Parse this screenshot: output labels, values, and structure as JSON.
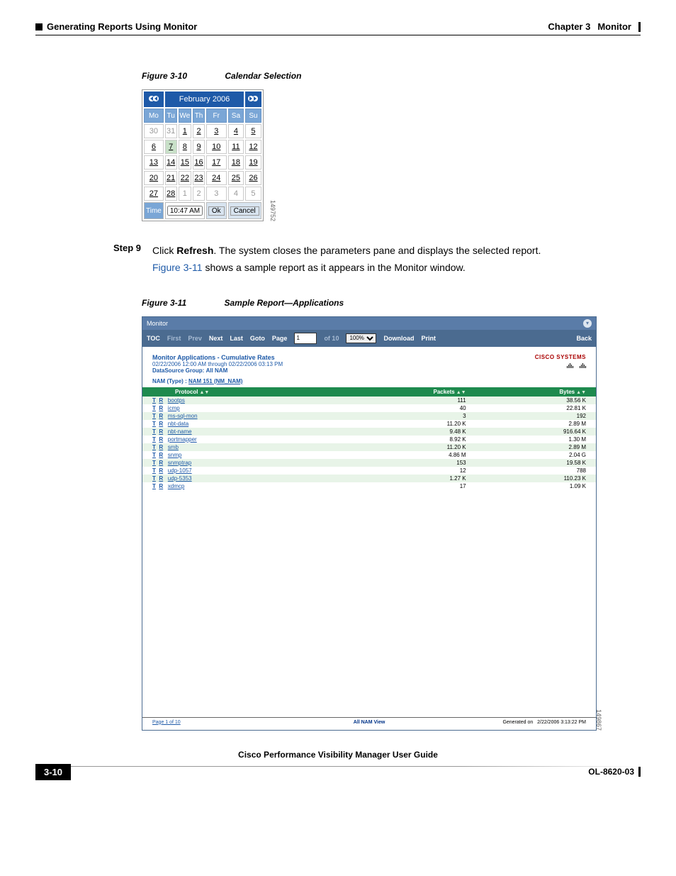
{
  "header": {
    "chapter": "Chapter 3",
    "chapter_title": "Monitor",
    "section": "Generating Reports Using Monitor"
  },
  "figure310": {
    "label": "Figure 3-10",
    "title": "Calendar Selection",
    "image_id": "149752"
  },
  "calendar": {
    "month": "February 2006",
    "dows": [
      "Mo",
      "Tu",
      "We",
      "Th",
      "Fr",
      "Sa",
      "Su"
    ],
    "rows": [
      [
        {
          "d": "30",
          "m": true
        },
        {
          "d": "31",
          "m": true
        },
        {
          "d": "1"
        },
        {
          "d": "2"
        },
        {
          "d": "3"
        },
        {
          "d": "4"
        },
        {
          "d": "5"
        }
      ],
      [
        {
          "d": "6"
        },
        {
          "d": "7",
          "sel": true
        },
        {
          "d": "8"
        },
        {
          "d": "9"
        },
        {
          "d": "10"
        },
        {
          "d": "11"
        },
        {
          "d": "12"
        }
      ],
      [
        {
          "d": "13"
        },
        {
          "d": "14"
        },
        {
          "d": "15"
        },
        {
          "d": "16"
        },
        {
          "d": "17"
        },
        {
          "d": "18"
        },
        {
          "d": "19"
        }
      ],
      [
        {
          "d": "20"
        },
        {
          "d": "21"
        },
        {
          "d": "22"
        },
        {
          "d": "23"
        },
        {
          "d": "24"
        },
        {
          "d": "25"
        },
        {
          "d": "26"
        }
      ],
      [
        {
          "d": "27"
        },
        {
          "d": "28"
        },
        {
          "d": "1",
          "m": true
        },
        {
          "d": "2",
          "m": true
        },
        {
          "d": "3",
          "m": true
        },
        {
          "d": "4",
          "m": true
        },
        {
          "d": "5",
          "m": true
        }
      ]
    ],
    "time_label": "Time",
    "time_value": "10:47 AM",
    "ok": "Ok",
    "cancel": "Cancel"
  },
  "step9": {
    "label": "Step 9",
    "text_before": "Click ",
    "bold": "Refresh",
    "text_after": ". The system closes the parameters pane and displays the selected report.",
    "link": "Figure 3-11",
    "line2": " shows a sample report as it appears in the Monitor window."
  },
  "figure311": {
    "label": "Figure 3-11",
    "title": "Sample Report—Applications",
    "image_id": "149867"
  },
  "monitor": {
    "title": "Monitor",
    "nav": {
      "toc": "TOC",
      "first": "First",
      "prev": "Prev",
      "next": "Next",
      "last": "Last",
      "goto": "Goto",
      "page_label": "Page",
      "page_value": "1",
      "of": "of 10",
      "zoom": "100%",
      "download": "Download",
      "print": "Print",
      "back": "Back"
    },
    "report_title": "Monitor Applications - Cumulative Rates",
    "report_time": "02/22/2006 12:00 AM through 02/22/2006 03:13 PM",
    "datasource_label": "DataSource Group:",
    "datasource_value": "All NAM",
    "nam_type": "NAM (Type) :",
    "nam_link": "NAM 151 (NM_NAM)",
    "logo_text": "CISCO SYSTEMS",
    "table": {
      "headers": [
        "Protocol",
        "Packets",
        "Bytes"
      ],
      "rows": [
        {
          "t": "T",
          "r": "R",
          "protocol": "bootps",
          "packets": "111",
          "bytes": "38.56 K"
        },
        {
          "t": "T",
          "r": "R",
          "protocol": "icmp",
          "packets": "40",
          "bytes": "22.81 K"
        },
        {
          "t": "T",
          "r": "R",
          "protocol": "ms-sql-mon",
          "packets": "3",
          "bytes": "192"
        },
        {
          "t": "T",
          "r": "R",
          "protocol": "nbt-data",
          "packets": "11.20 K",
          "bytes": "2.89 M"
        },
        {
          "t": "T",
          "r": "R",
          "protocol": "nbt-name",
          "packets": "9.48 K",
          "bytes": "916.64 K"
        },
        {
          "t": "T",
          "r": "R",
          "protocol": "portmapper",
          "packets": "8.92 K",
          "bytes": "1.30 M"
        },
        {
          "t": "T",
          "r": "R",
          "protocol": "smb",
          "packets": "11.20 K",
          "bytes": "2.89 M"
        },
        {
          "t": "T",
          "r": "R",
          "protocol": "snmp",
          "packets": "4.86 M",
          "bytes": "2.04 G"
        },
        {
          "t": "T",
          "r": "R",
          "protocol": "snmptrap",
          "packets": "153",
          "bytes": "19.58 K"
        },
        {
          "t": "T",
          "r": "R",
          "protocol": "udp-1057",
          "packets": "12",
          "bytes": "788"
        },
        {
          "t": "T",
          "r": "R",
          "protocol": "udp-5353",
          "packets": "1.27 K",
          "bytes": "110.23 K"
        },
        {
          "t": "T",
          "r": "R",
          "protocol": "xdmcp",
          "packets": "17",
          "bytes": "1.09 K"
        }
      ]
    },
    "footer": {
      "page": "Page 1 of 10",
      "center": "All NAM View",
      "gen_label": "Generated on",
      "gen_value": "2/22/2006 3:13:22 PM"
    }
  },
  "page_footer": {
    "doc_title": "Cisco Performance Visibility Manager User Guide",
    "page_num": "3-10",
    "doc_num": "OL-8620-03"
  }
}
